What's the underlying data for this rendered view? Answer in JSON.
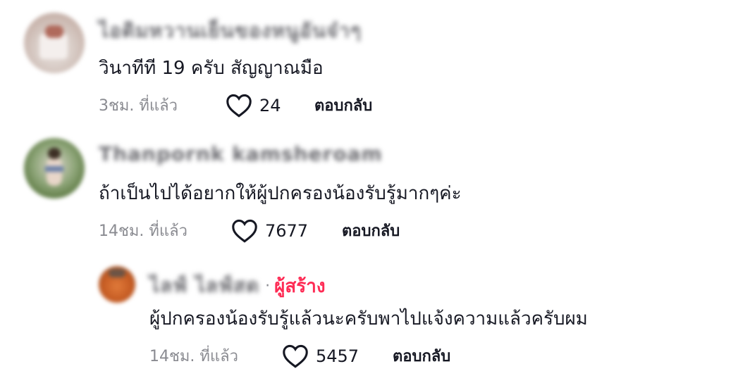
{
  "comments": [
    {
      "username": "ไอติมหวานเย็นของหนูอันจ๋าๆ",
      "text": "วินาทีที 19 ครับ สัญญาณมือ",
      "time": "3ชม. ที่แล้ว",
      "likes": "24",
      "reply_label": "ตอบกลับ"
    },
    {
      "username": "Thanpornk kamsheroam",
      "text": "ถ้าเป็นไปได้อยากให้ผู้ปกครองน้องรับรู้มากๆค่ะ",
      "time": "14ชม. ที่แล้ว",
      "likes": "7677",
      "reply_label": "ตอบกลับ"
    }
  ],
  "reply": {
    "username": "ไลฟ์ ไลฟ์สด",
    "separator": "·",
    "badge": "ผู้สร้าง",
    "text": "ผู้ปกครองน้องรับรู้แล้วนะครับพาไปแจ้งความแล้วครับผม",
    "time": "14ชม. ที่แล้ว",
    "likes": "5457",
    "reply_label": "ตอบกลับ"
  },
  "colors": {
    "creator_badge": "#fe2c55",
    "meta_text": "#8a8b91",
    "primary_text": "#161823"
  }
}
